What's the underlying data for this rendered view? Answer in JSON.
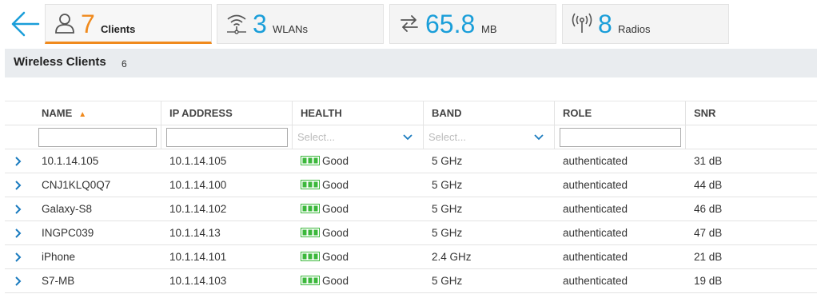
{
  "summary": {
    "clients": {
      "value": "7",
      "label": "Clients"
    },
    "wlans": {
      "value": "3",
      "label": "WLANs"
    },
    "usage": {
      "value": "65.8",
      "label": "MB"
    },
    "radios": {
      "value": "8",
      "label": "Radios"
    }
  },
  "section": {
    "title": "Wireless Clients",
    "count": "6"
  },
  "table": {
    "columns": {
      "name": "NAME",
      "ip": "IP ADDRESS",
      "health": "HEALTH",
      "band": "BAND",
      "role": "ROLE",
      "snr": "SNR"
    },
    "filters": {
      "name": "",
      "ip": "",
      "health_placeholder": "Select...",
      "band_placeholder": "Select...",
      "role": ""
    },
    "rows": [
      {
        "name": "10.1.14.105",
        "ip": "10.1.14.105",
        "health": "Good",
        "band": "5 GHz",
        "role": "authenticated",
        "snr": "31 dB"
      },
      {
        "name": "CNJ1KLQ0Q7",
        "ip": "10.1.14.100",
        "health": "Good",
        "band": "5 GHz",
        "role": "authenticated",
        "snr": "44 dB"
      },
      {
        "name": "Galaxy-S8",
        "ip": "10.1.14.102",
        "health": "Good",
        "band": "5 GHz",
        "role": "authenticated",
        "snr": "46 dB"
      },
      {
        "name": "INGPC039",
        "ip": "10.1.14.13",
        "health": "Good",
        "band": "5 GHz",
        "role": "authenticated",
        "snr": "47 dB"
      },
      {
        "name": "iPhone",
        "ip": "10.1.14.101",
        "health": "Good",
        "band": "2.4 GHz",
        "role": "authenticated",
        "snr": "21 dB"
      },
      {
        "name": "S7-MB",
        "ip": "10.1.14.103",
        "health": "Good",
        "band": "5 GHz",
        "role": "authenticated",
        "snr": "19 dB"
      }
    ]
  },
  "colors": {
    "accent_blue": "#1a9ed9",
    "active_orange": "#f08a1d",
    "health_good": "#3cb83c"
  }
}
